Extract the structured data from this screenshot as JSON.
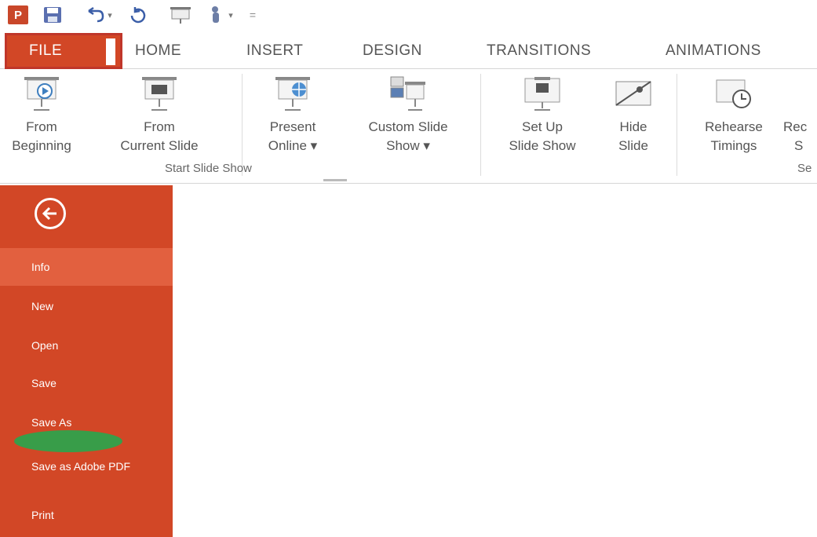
{
  "quick_access": {
    "app_icon_letter": "P",
    "more_label": "="
  },
  "tabs": [
    {
      "id": "file",
      "label": "FILE"
    },
    {
      "id": "home",
      "label": "HOME"
    },
    {
      "id": "insert",
      "label": "INSERT"
    },
    {
      "id": "design",
      "label": "DESIGN"
    },
    {
      "id": "transitions",
      "label": "TRANSITIONS"
    },
    {
      "id": "animations",
      "label": "ANIMATIONS"
    }
  ],
  "ribbon": {
    "buttons": [
      {
        "label_line1": "From",
        "label_line2": "Beginning",
        "icon": "projector-play-icon"
      },
      {
        "label_line1": "From",
        "label_line2": "Current Slide",
        "icon": "projector-current-icon"
      },
      {
        "label_line1": "Present",
        "label_line2": "Online ▾",
        "icon": "present-online-icon"
      },
      {
        "label_line1": "Custom Slide",
        "label_line2": "Show ▾",
        "icon": "custom-show-icon"
      },
      {
        "label_line1": "Set Up",
        "label_line2": "Slide Show",
        "icon": "setup-slideshow-icon"
      },
      {
        "label_line1": "Hide",
        "label_line2": "Slide",
        "icon": "hide-slide-icon"
      },
      {
        "label_line1": "Rehearse",
        "label_line2": "Timings",
        "icon": "rehearse-timings-icon"
      },
      {
        "label_line1": "Rec",
        "label_line2": "S",
        "icon": "record-icon"
      }
    ],
    "groups": [
      {
        "label": "Start Slide Show"
      },
      {
        "label": "Se"
      }
    ]
  },
  "backstage": {
    "items": [
      {
        "label": "Info",
        "selected": true
      },
      {
        "label": "New"
      },
      {
        "label": "Open"
      },
      {
        "label": "Save"
      },
      {
        "label": "Save As"
      },
      {
        "label": "Save as Adobe PDF"
      },
      {
        "label": "Print"
      }
    ]
  },
  "colors": {
    "file_accent": "#d24726",
    "selected_item": "#e2603f",
    "highlight_mark": "#2fa24b"
  }
}
